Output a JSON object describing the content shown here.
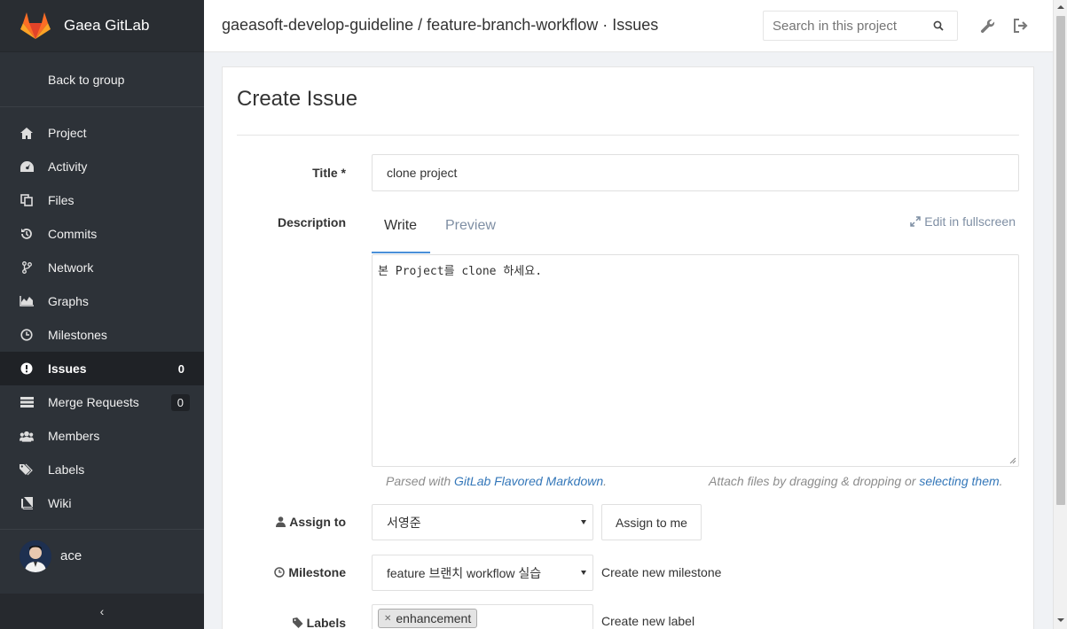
{
  "app": {
    "name": "Gaea GitLab"
  },
  "sidebar": {
    "back_label": "Back to group",
    "items": [
      {
        "label": "Project",
        "icon": "home-icon"
      },
      {
        "label": "Activity",
        "icon": "dashboard-icon"
      },
      {
        "label": "Files",
        "icon": "files-icon"
      },
      {
        "label": "Commits",
        "icon": "history-icon"
      },
      {
        "label": "Network",
        "icon": "branch-icon"
      },
      {
        "label": "Graphs",
        "icon": "area-chart-icon"
      },
      {
        "label": "Milestones",
        "icon": "clock-icon"
      },
      {
        "label": "Issues",
        "icon": "exclamation-circle-icon",
        "count": "0",
        "active": true
      },
      {
        "label": "Merge Requests",
        "icon": "tasks-icon",
        "count": "0"
      },
      {
        "label": "Members",
        "icon": "users-icon"
      },
      {
        "label": "Labels",
        "icon": "tags-icon"
      },
      {
        "label": "Wiki",
        "icon": "book-icon"
      }
    ],
    "user": {
      "name": "ace"
    },
    "collapse_label": "‹"
  },
  "header": {
    "breadcrumb": "gaeasoft-develop-guideline / feature-branch-workflow · Issues",
    "search_placeholder": "Search in this project"
  },
  "form": {
    "page_title": "Create Issue",
    "title_label": "Title *",
    "title_value": "clone project",
    "description_label": "Description",
    "tab_write": "Write",
    "tab_preview": "Preview",
    "fullscreen_label": "Edit in fullscreen",
    "description_value": "본 Project를 clone 하세요.",
    "hint_parsed_prefix": "Parsed with ",
    "hint_parsed_link": "GitLab Flavored Markdown",
    "hint_parsed_suffix": ".",
    "hint_attach_prefix": "Attach files by dragging & dropping or ",
    "hint_attach_link": "selecting them",
    "hint_attach_suffix": ".",
    "assign_label": "Assign to",
    "assign_value": "서영준",
    "assign_me_label": "Assign to me",
    "milestone_label": "Milestone",
    "milestone_value": "feature 브랜치 workflow 실습",
    "new_milestone_label": "Create new milestone",
    "labels_label": "Labels",
    "label_tag": "enhancement",
    "new_label_label": "Create new label"
  },
  "colors": {
    "sidebar_bg": "#2d3238",
    "active_bg": "#1f2226",
    "link": "#3477b9",
    "tab_accent": "#4a90d9"
  }
}
